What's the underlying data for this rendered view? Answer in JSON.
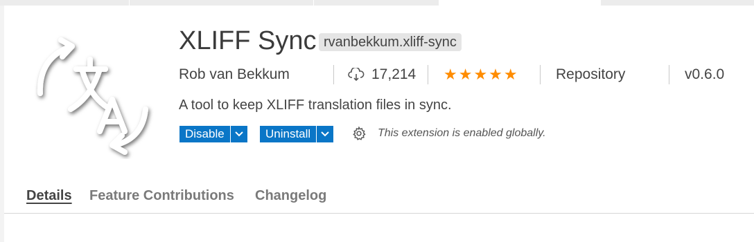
{
  "extension": {
    "name": "XLIFF Sync",
    "identifier": "rvanbekkum.xliff-sync",
    "publisher": "Rob van Bekkum",
    "installs": "17,214",
    "rating_stars": "★★★★★",
    "repository_label": "Repository",
    "version": "v0.6.0",
    "description": "A tool to keep XLIFF translation files in sync."
  },
  "actions": {
    "disable_label": "Disable",
    "uninstall_label": "Uninstall",
    "status_text": "This extension is enabled globally."
  },
  "tabs": [
    {
      "label": "Details"
    },
    {
      "label": "Feature Contributions"
    },
    {
      "label": "Changelog"
    }
  ],
  "colors": {
    "button_blue": "#0a76c7",
    "star_orange": "#ff8c00"
  },
  "icons": {
    "logo": "translate-icon",
    "installs": "cloud-download-icon",
    "settings": "gear-icon",
    "dropdown": "chevron-down-icon"
  }
}
